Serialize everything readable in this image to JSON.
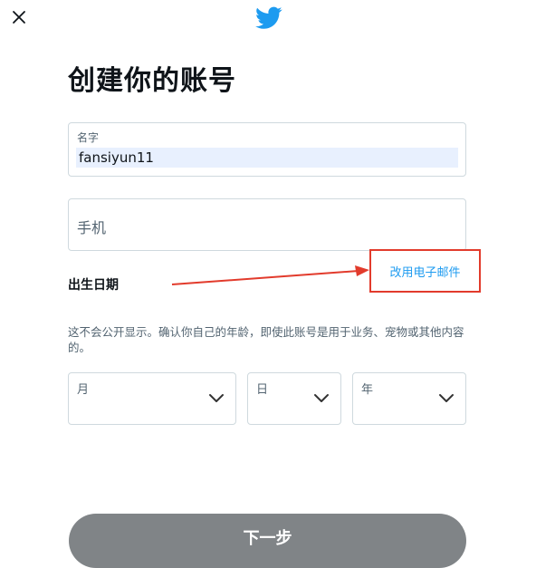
{
  "colors": {
    "brand": "#1d9bf0",
    "highlight_box": "#e23b2c",
    "button_bg": "#808487"
  },
  "header": {
    "close_icon": "close-icon",
    "logo_icon": "twitter-bird-icon"
  },
  "page": {
    "title": "创建你的账号"
  },
  "name_field": {
    "label": "名字",
    "value": "fansiyun11"
  },
  "phone_field": {
    "placeholder": "手机"
  },
  "switch_link": {
    "label": "改用电子邮件"
  },
  "dob": {
    "title": "出生日期",
    "description": "这不会公开显示。确认你自己的年龄，即使此账号是用于业务、宠物或其他内容的。",
    "month_label": "月",
    "day_label": "日",
    "year_label": "年"
  },
  "next_button": {
    "label": "下一步"
  }
}
